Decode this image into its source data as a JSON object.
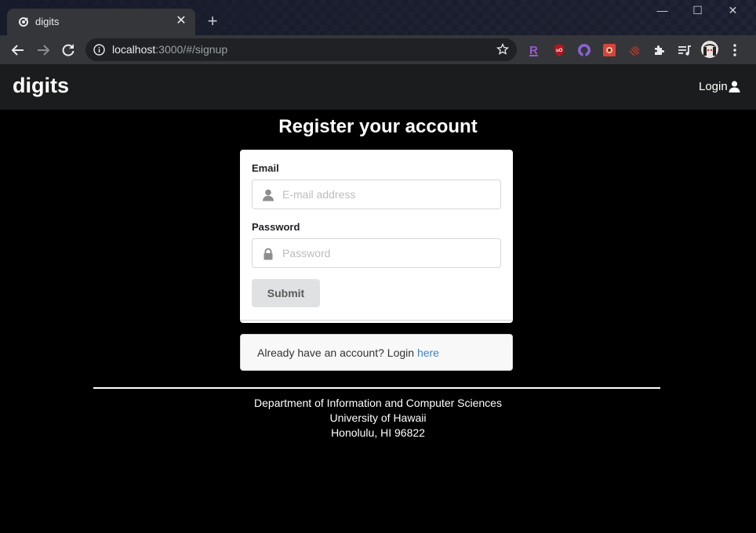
{
  "browser": {
    "tab_title": "digits",
    "new_tab_symbol": "+",
    "close_symbol": "✕",
    "url_host": "localhost",
    "url_rest": ":3000/#/signup",
    "window_controls": {
      "minimize": "—",
      "maximize": "☐",
      "close": "✕"
    },
    "extensions": [
      "r-extension-icon",
      "ublock-icon",
      "github-icon",
      "media-extension-icon",
      "stripes-extension-icon",
      "puzzle-extensions-icon",
      "media-queue-icon",
      "profile-avatar"
    ]
  },
  "navbar": {
    "brand": "digits",
    "login_label": "Login"
  },
  "page": {
    "title": "Register your account"
  },
  "form": {
    "email_label": "Email",
    "email_placeholder": "E-mail address",
    "password_label": "Password",
    "password_placeholder": "Password",
    "submit_label": "Submit"
  },
  "message": {
    "text": "Already have an account? Login ",
    "link_label": "here"
  },
  "footer": {
    "line1": "Department of Information and Computer Sciences",
    "line2": "University of Hawaii",
    "line3": "Honolulu, HI 96822"
  },
  "colors": {
    "page_background": "#000000",
    "navbar_background": "#1b1c1d",
    "link": "#4183c4",
    "button_background": "#e0e1e2"
  }
}
